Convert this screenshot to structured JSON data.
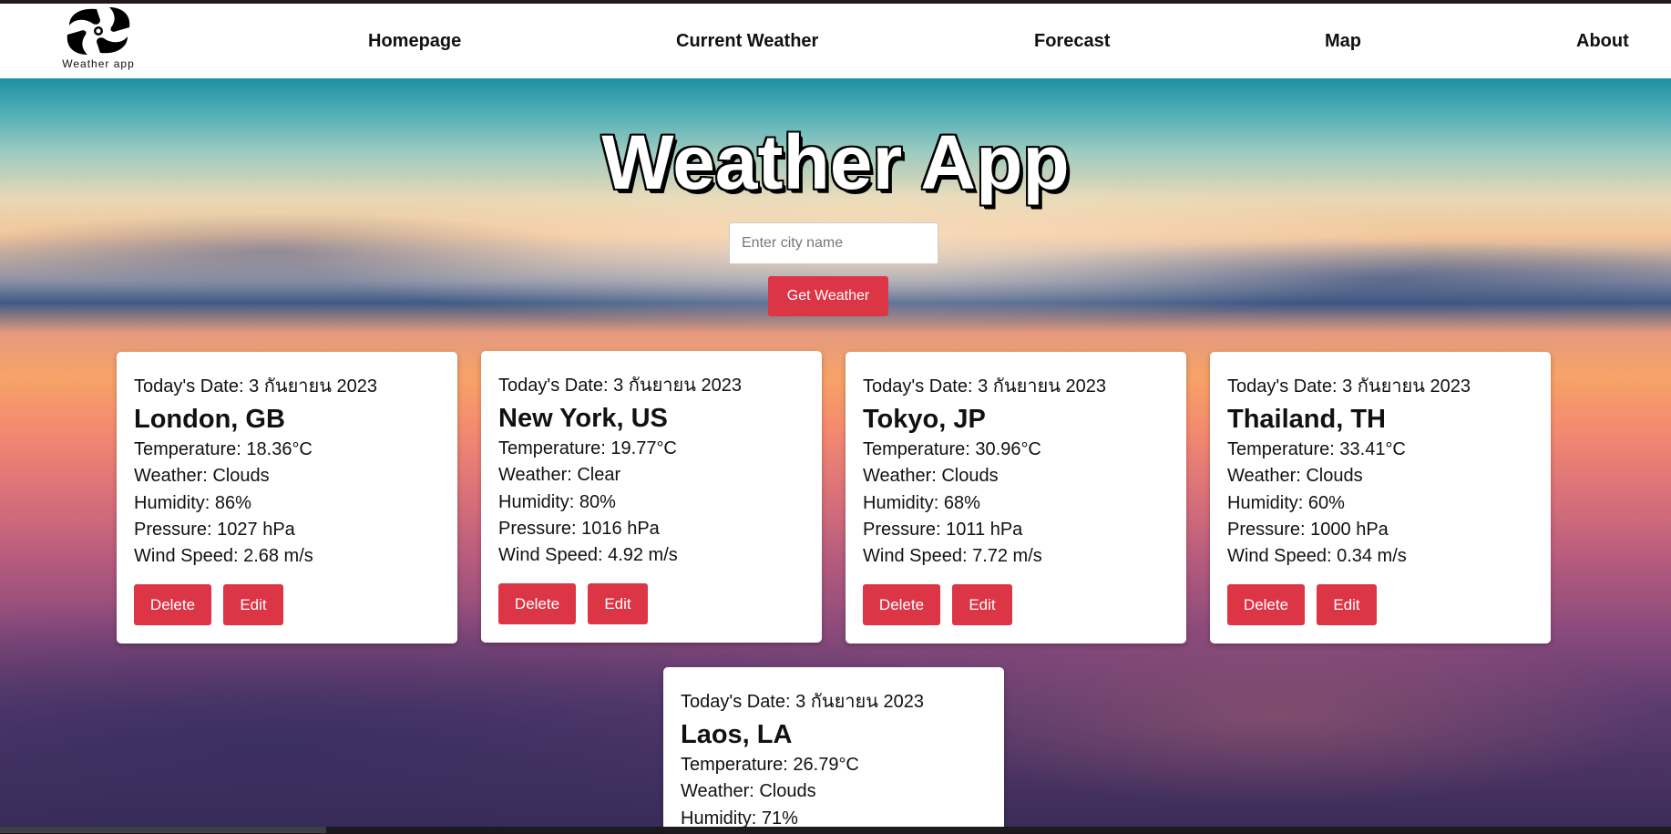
{
  "nav": {
    "logo_text": "Weather app",
    "links": [
      "Homepage",
      "Current Weather",
      "Forecast",
      "Map",
      "About"
    ]
  },
  "hero": {
    "title": "Weather App",
    "search_placeholder": "Enter city name",
    "get_weather_label": "Get Weather"
  },
  "cards": [
    {
      "date": "Today's Date: 3 กันยายน 2023",
      "city": "London, GB",
      "temperature": "Temperature: 18.36°C",
      "weather": "Weather: Clouds",
      "humidity": "Humidity: 86%",
      "pressure": "Pressure: 1027 hPa",
      "wind": "Wind Speed: 2.68 m/s",
      "delete_label": "Delete",
      "edit_label": "Edit"
    },
    {
      "date": "Today's Date: 3 กันยายน 2023",
      "city": "New York, US",
      "temperature": "Temperature: 19.77°C",
      "weather": "Weather: Clear",
      "humidity": "Humidity: 80%",
      "pressure": "Pressure: 1016 hPa",
      "wind": "Wind Speed: 4.92 m/s",
      "delete_label": "Delete",
      "edit_label": "Edit"
    },
    {
      "date": "Today's Date: 3 กันยายน 2023",
      "city": "Tokyo, JP",
      "temperature": "Temperature: 30.96°C",
      "weather": "Weather: Clouds",
      "humidity": "Humidity: 68%",
      "pressure": "Pressure: 1011 hPa",
      "wind": "Wind Speed: 7.72 m/s",
      "delete_label": "Delete",
      "edit_label": "Edit"
    },
    {
      "date": "Today's Date: 3 กันยายน 2023",
      "city": "Thailand, TH",
      "temperature": "Temperature: 33.41°C",
      "weather": "Weather: Clouds",
      "humidity": "Humidity: 60%",
      "pressure": "Pressure: 1000 hPa",
      "wind": "Wind Speed: 0.34 m/s",
      "delete_label": "Delete",
      "edit_label": "Edit"
    },
    {
      "date": "Today's Date: 3 กันยายน 2023",
      "city": "Laos, LA",
      "temperature": "Temperature: 26.79°C",
      "weather": "Weather: Clouds",
      "humidity": "Humidity: 71%"
    }
  ],
  "colors": {
    "accent": "#dc3545",
    "navbar": "#ffffff",
    "card": "#ffffff"
  },
  "icons": {
    "logo": "swirl-logo-icon"
  }
}
